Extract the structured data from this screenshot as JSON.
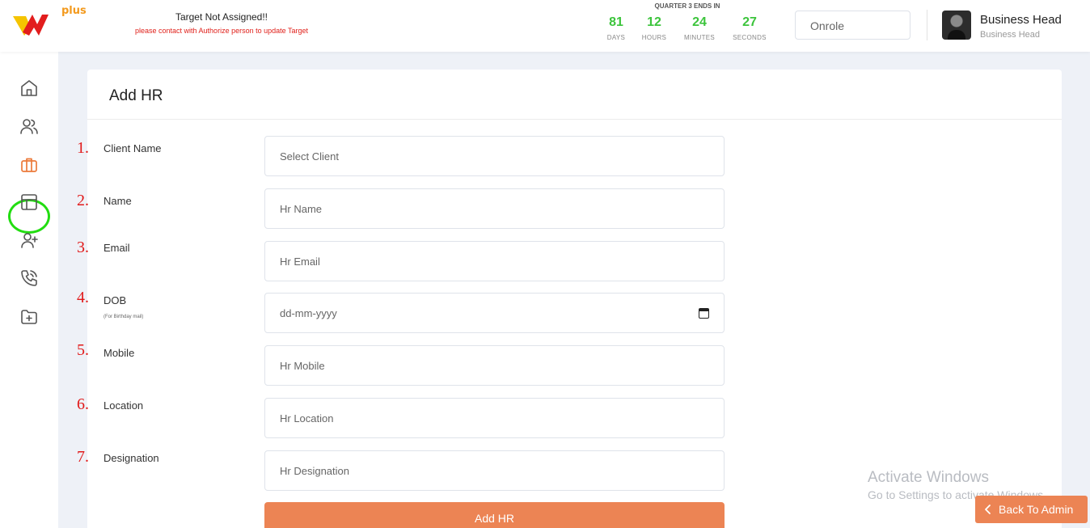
{
  "header": {
    "logo_plus": "plus",
    "target_title": "Target Not Assigned!!",
    "target_subtitle": "please contact with Authorize person to update Target",
    "quarter_title": "QUARTER 3 ENDS IN",
    "countdown": [
      {
        "value": "81",
        "label": "DAYS"
      },
      {
        "value": "12",
        "label": "HOURS"
      },
      {
        "value": "24",
        "label": "MINUTES"
      },
      {
        "value": "27",
        "label": "SECONDS"
      }
    ],
    "role_select": "Onrole",
    "user_name": "Business Head",
    "user_role": "Business Head"
  },
  "sidebar": {
    "icons": [
      "home-icon",
      "users-icon",
      "briefcase-icon",
      "layout-icon",
      "user-plus-icon",
      "phone-icon",
      "folder-plus-icon"
    ],
    "active": "briefcase-icon"
  },
  "form": {
    "title": "Add HR",
    "fields": [
      {
        "number": "1.",
        "label": "Client Name",
        "placeholder": "Select Client"
      },
      {
        "number": "2.",
        "label": "Name",
        "placeholder": "Hr Name"
      },
      {
        "number": "3.",
        "label": "Email",
        "placeholder": "Hr Email"
      },
      {
        "number": "4.",
        "label": "DOB",
        "sublabel": "(For Birthday mail)",
        "placeholder": "dd-mm-yyyy"
      },
      {
        "number": "5.",
        "label": "Mobile",
        "placeholder": "Hr Mobile"
      },
      {
        "number": "6.",
        "label": "Location",
        "placeholder": "Hr Location"
      },
      {
        "number": "7.",
        "label": "Designation",
        "placeholder": "Hr Designation"
      }
    ],
    "submit_label": "Add HR"
  },
  "watermark": {
    "title": "Activate Windows",
    "subtitle": "Go to Settings to activate Windows."
  },
  "back_button": "Back To Admin",
  "colors": {
    "accent": "#ec8454",
    "countdown": "#3cc43c",
    "warning": "#e0211b",
    "annotation": "#e11919",
    "highlight_ring": "#22dd11"
  }
}
